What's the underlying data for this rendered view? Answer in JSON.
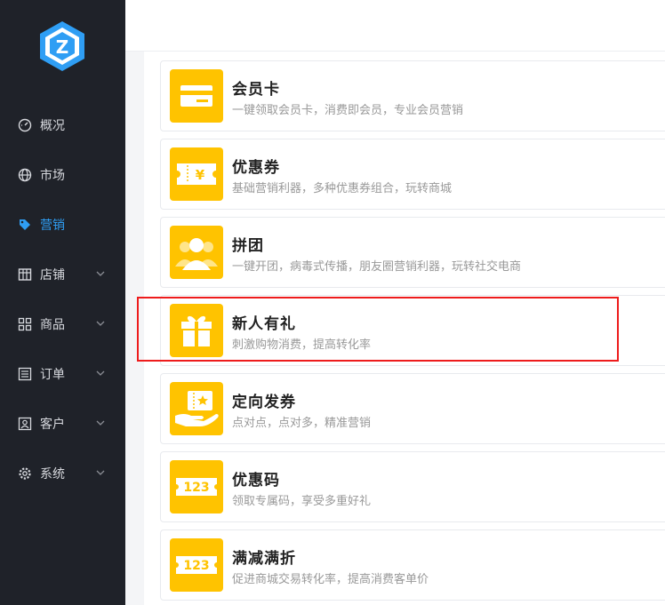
{
  "sidebar": {
    "logo": "Z",
    "accent_color": "#2f9ef4",
    "items": [
      {
        "label": "概况",
        "icon": "dashboard-icon"
      },
      {
        "label": "市场",
        "icon": "globe-icon"
      },
      {
        "label": "营销",
        "icon": "tag-icon",
        "active": true
      },
      {
        "label": "店铺",
        "icon": "store-icon",
        "expandable": true
      },
      {
        "label": "商品",
        "icon": "grid-icon",
        "expandable": true
      },
      {
        "label": "订单",
        "icon": "list-icon",
        "expandable": true
      },
      {
        "label": "客户",
        "icon": "customer-icon",
        "expandable": true
      },
      {
        "label": "系统",
        "icon": "gear-icon",
        "expandable": true
      }
    ]
  },
  "marketing_cards": [
    {
      "title": "会员卡",
      "desc": "一键领取会员卡，消费即会员，专业会员营销",
      "icon": "member-card-icon"
    },
    {
      "title": "优惠券",
      "desc": "基础营销利器，多种优惠券组合，玩转商城",
      "icon": "coupon-icon"
    },
    {
      "title": "拼团",
      "desc": "一键开团，病毒式传播，朋友圈营销利器，玩转社交电商",
      "icon": "group-buy-icon"
    },
    {
      "title": "新人有礼",
      "desc": "刺激购物消费，提高转化率",
      "icon": "gift-icon",
      "highlighted": true
    },
    {
      "title": "定向发券",
      "desc": "点对点，点对多，精准营销",
      "icon": "targeted-coupon-icon"
    },
    {
      "title": "优惠码",
      "desc": "领取专属码，享受多重好礼",
      "icon": "promo-code-icon",
      "badge": "123"
    },
    {
      "title": "满减满折",
      "desc": "促进商城交易转化率，提高消费客单价",
      "icon": "discount-icon",
      "badge": "123"
    }
  ],
  "colors": {
    "tile": "#ffc300",
    "sidebar_bg": "#1f2229",
    "highlight": "#ee1c1c"
  }
}
